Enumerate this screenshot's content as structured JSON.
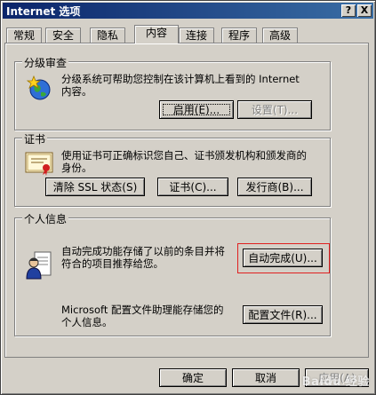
{
  "window": {
    "title": "Internet 选项",
    "help_button": "?",
    "close_button": "X"
  },
  "tabs": [
    "常规",
    "安全",
    "隐私",
    "内容",
    "连接",
    "程序",
    "高级"
  ],
  "active_tab": "内容",
  "content_advisor": {
    "label": "分级审查",
    "description_line1": "分级系统可帮助您控制在该计算机上看到的 Internet",
    "description_line2": "内容。",
    "enable_button": "启用(E)...",
    "settings_button": "设置(T)..."
  },
  "certificates": {
    "label": "证书",
    "description_line1": "使用证书可正确标识您自己、证书颁发机构和颁发商的",
    "description_line2": "身份。",
    "clear_ssl_button": "清除 SSL 状态(S)",
    "certificates_button": "证书(C)...",
    "publishers_button": "发行商(B)..."
  },
  "personal_info": {
    "label": "个人信息",
    "autocomplete_line1": "自动完成功能存储了以前的条目并将",
    "autocomplete_line2": "符合的项目推荐给您。",
    "autocomplete_button": "自动完成(U)...",
    "profile_line1": "Microsoft 配置文件助理能存储您的",
    "profile_line2": "个人信息。",
    "profile_button": "配置文件(R)..."
  },
  "footer": {
    "ok_button": "确定",
    "cancel_button": "取消",
    "apply_button": "应用(A)"
  },
  "watermark": "Baidu 经验",
  "colors": {
    "title_bar": "#0a246a",
    "face": "#d4d0c8",
    "highlight_box": "#e02020"
  }
}
